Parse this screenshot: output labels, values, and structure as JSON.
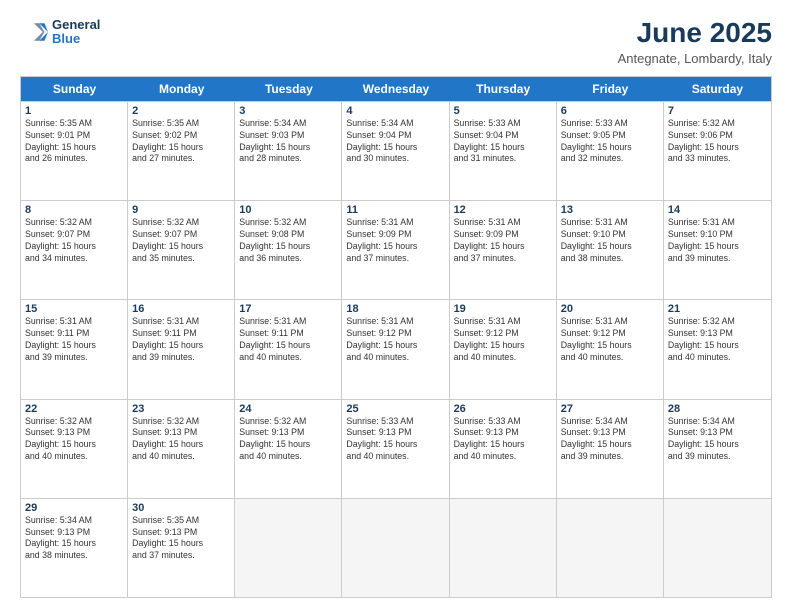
{
  "logo": {
    "line1": "General",
    "line2": "Blue"
  },
  "title": "June 2025",
  "location": "Antegnate, Lombardy, Italy",
  "header_days": [
    "Sunday",
    "Monday",
    "Tuesday",
    "Wednesday",
    "Thursday",
    "Friday",
    "Saturday"
  ],
  "rows": [
    [
      {
        "day": "1",
        "lines": [
          "Sunrise: 5:35 AM",
          "Sunset: 9:01 PM",
          "Daylight: 15 hours",
          "and 26 minutes."
        ]
      },
      {
        "day": "2",
        "lines": [
          "Sunrise: 5:35 AM",
          "Sunset: 9:02 PM",
          "Daylight: 15 hours",
          "and 27 minutes."
        ]
      },
      {
        "day": "3",
        "lines": [
          "Sunrise: 5:34 AM",
          "Sunset: 9:03 PM",
          "Daylight: 15 hours",
          "and 28 minutes."
        ]
      },
      {
        "day": "4",
        "lines": [
          "Sunrise: 5:34 AM",
          "Sunset: 9:04 PM",
          "Daylight: 15 hours",
          "and 30 minutes."
        ]
      },
      {
        "day": "5",
        "lines": [
          "Sunrise: 5:33 AM",
          "Sunset: 9:04 PM",
          "Daylight: 15 hours",
          "and 31 minutes."
        ]
      },
      {
        "day": "6",
        "lines": [
          "Sunrise: 5:33 AM",
          "Sunset: 9:05 PM",
          "Daylight: 15 hours",
          "and 32 minutes."
        ]
      },
      {
        "day": "7",
        "lines": [
          "Sunrise: 5:32 AM",
          "Sunset: 9:06 PM",
          "Daylight: 15 hours",
          "and 33 minutes."
        ]
      }
    ],
    [
      {
        "day": "8",
        "lines": [
          "Sunrise: 5:32 AM",
          "Sunset: 9:07 PM",
          "Daylight: 15 hours",
          "and 34 minutes."
        ]
      },
      {
        "day": "9",
        "lines": [
          "Sunrise: 5:32 AM",
          "Sunset: 9:07 PM",
          "Daylight: 15 hours",
          "and 35 minutes."
        ]
      },
      {
        "day": "10",
        "lines": [
          "Sunrise: 5:32 AM",
          "Sunset: 9:08 PM",
          "Daylight: 15 hours",
          "and 36 minutes."
        ]
      },
      {
        "day": "11",
        "lines": [
          "Sunrise: 5:31 AM",
          "Sunset: 9:09 PM",
          "Daylight: 15 hours",
          "and 37 minutes."
        ]
      },
      {
        "day": "12",
        "lines": [
          "Sunrise: 5:31 AM",
          "Sunset: 9:09 PM",
          "Daylight: 15 hours",
          "and 37 minutes."
        ]
      },
      {
        "day": "13",
        "lines": [
          "Sunrise: 5:31 AM",
          "Sunset: 9:10 PM",
          "Daylight: 15 hours",
          "and 38 minutes."
        ]
      },
      {
        "day": "14",
        "lines": [
          "Sunrise: 5:31 AM",
          "Sunset: 9:10 PM",
          "Daylight: 15 hours",
          "and 39 minutes."
        ]
      }
    ],
    [
      {
        "day": "15",
        "lines": [
          "Sunrise: 5:31 AM",
          "Sunset: 9:11 PM",
          "Daylight: 15 hours",
          "and 39 minutes."
        ]
      },
      {
        "day": "16",
        "lines": [
          "Sunrise: 5:31 AM",
          "Sunset: 9:11 PM",
          "Daylight: 15 hours",
          "and 39 minutes."
        ]
      },
      {
        "day": "17",
        "lines": [
          "Sunrise: 5:31 AM",
          "Sunset: 9:11 PM",
          "Daylight: 15 hours",
          "and 40 minutes."
        ]
      },
      {
        "day": "18",
        "lines": [
          "Sunrise: 5:31 AM",
          "Sunset: 9:12 PM",
          "Daylight: 15 hours",
          "and 40 minutes."
        ]
      },
      {
        "day": "19",
        "lines": [
          "Sunrise: 5:31 AM",
          "Sunset: 9:12 PM",
          "Daylight: 15 hours",
          "and 40 minutes."
        ]
      },
      {
        "day": "20",
        "lines": [
          "Sunrise: 5:31 AM",
          "Sunset: 9:12 PM",
          "Daylight: 15 hours",
          "and 40 minutes."
        ]
      },
      {
        "day": "21",
        "lines": [
          "Sunrise: 5:32 AM",
          "Sunset: 9:13 PM",
          "Daylight: 15 hours",
          "and 40 minutes."
        ]
      }
    ],
    [
      {
        "day": "22",
        "lines": [
          "Sunrise: 5:32 AM",
          "Sunset: 9:13 PM",
          "Daylight: 15 hours",
          "and 40 minutes."
        ]
      },
      {
        "day": "23",
        "lines": [
          "Sunrise: 5:32 AM",
          "Sunset: 9:13 PM",
          "Daylight: 15 hours",
          "and 40 minutes."
        ]
      },
      {
        "day": "24",
        "lines": [
          "Sunrise: 5:32 AM",
          "Sunset: 9:13 PM",
          "Daylight: 15 hours",
          "and 40 minutes."
        ]
      },
      {
        "day": "25",
        "lines": [
          "Sunrise: 5:33 AM",
          "Sunset: 9:13 PM",
          "Daylight: 15 hours",
          "and 40 minutes."
        ]
      },
      {
        "day": "26",
        "lines": [
          "Sunrise: 5:33 AM",
          "Sunset: 9:13 PM",
          "Daylight: 15 hours",
          "and 40 minutes."
        ]
      },
      {
        "day": "27",
        "lines": [
          "Sunrise: 5:34 AM",
          "Sunset: 9:13 PM",
          "Daylight: 15 hours",
          "and 39 minutes."
        ]
      },
      {
        "day": "28",
        "lines": [
          "Sunrise: 5:34 AM",
          "Sunset: 9:13 PM",
          "Daylight: 15 hours",
          "and 39 minutes."
        ]
      }
    ],
    [
      {
        "day": "29",
        "lines": [
          "Sunrise: 5:34 AM",
          "Sunset: 9:13 PM",
          "Daylight: 15 hours",
          "and 38 minutes."
        ]
      },
      {
        "day": "30",
        "lines": [
          "Sunrise: 5:35 AM",
          "Sunset: 9:13 PM",
          "Daylight: 15 hours",
          "and 37 minutes."
        ]
      },
      {
        "day": "",
        "lines": []
      },
      {
        "day": "",
        "lines": []
      },
      {
        "day": "",
        "lines": []
      },
      {
        "day": "",
        "lines": []
      },
      {
        "day": "",
        "lines": []
      }
    ]
  ]
}
